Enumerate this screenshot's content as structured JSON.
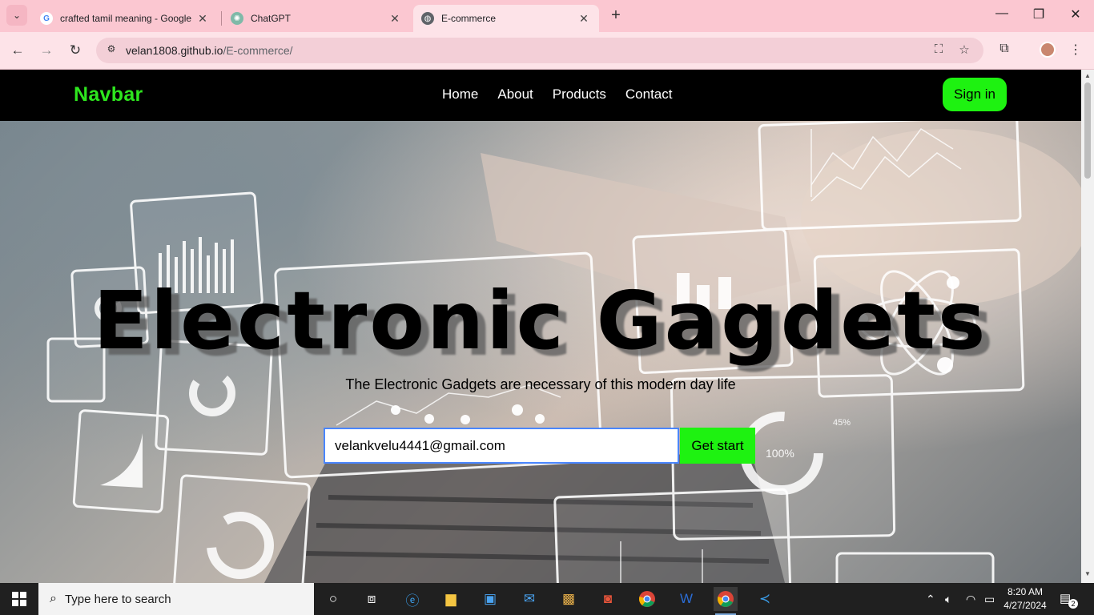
{
  "browser": {
    "tabs": [
      {
        "title": "crafted tamil meaning - Google",
        "favicon": "google-icon"
      },
      {
        "title": "ChatGPT",
        "favicon": "chatgpt-icon"
      },
      {
        "title": "E-commerce",
        "favicon": "globe-icon",
        "active": true
      }
    ],
    "new_tab": "+",
    "url_host": "velan1808.github.io",
    "url_path": "/E-commerce/"
  },
  "site": {
    "brand": "Navbar",
    "menu": [
      "Home",
      "About",
      "Products",
      "Contact"
    ],
    "signin_label": "Sign in",
    "accent_color": "#1ef211"
  },
  "hero": {
    "title": "Electronic Gagdets",
    "subtitle": "The Electronic Gadgets are necessary of this modern day life",
    "email_value": "velankvelu4441@gmail.com",
    "cta_label": "Get start",
    "overlay_labels": [
      "45%",
      "100%"
    ]
  },
  "taskbar": {
    "search_placeholder": "Type here to search",
    "time": "8:20 AM",
    "date": "4/27/2024",
    "notification_count": "2"
  }
}
